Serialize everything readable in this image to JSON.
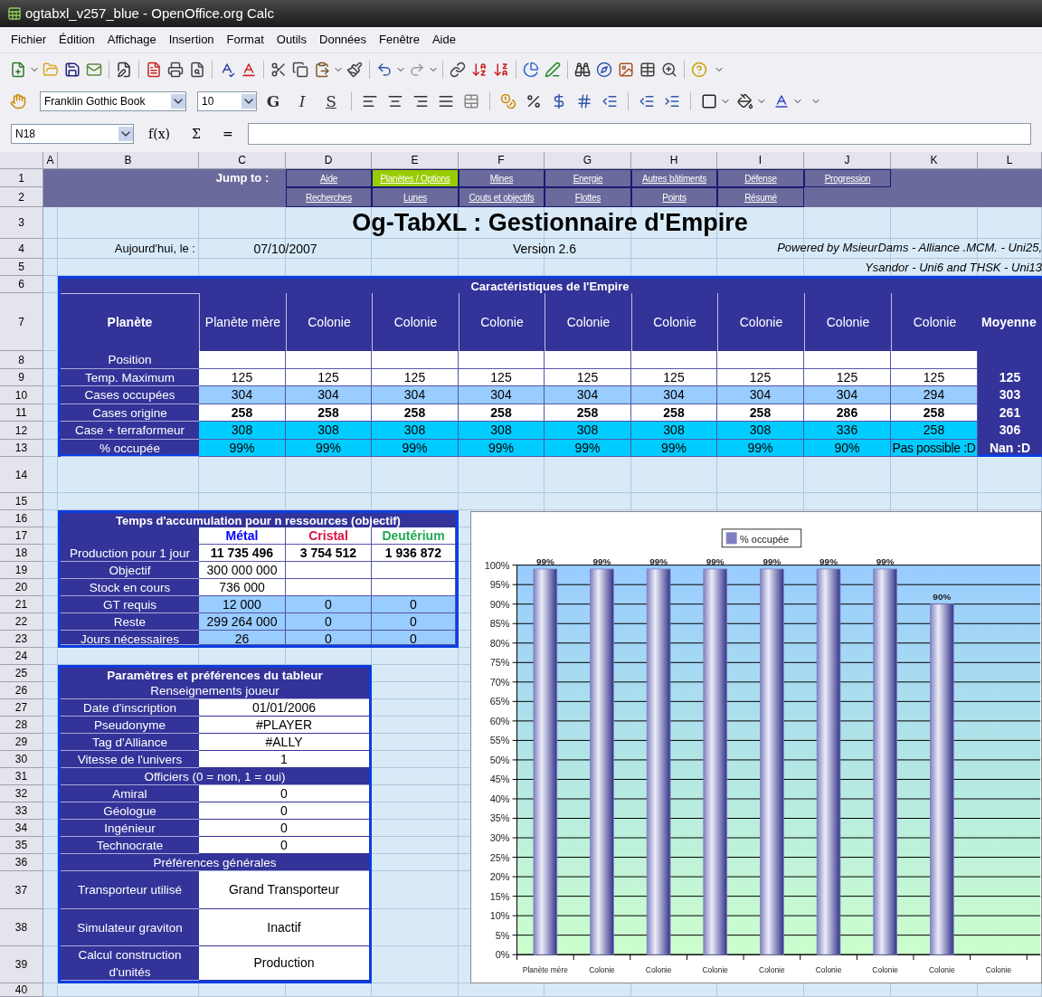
{
  "window": {
    "title": "ogtabxl_v257_blue - OpenOffice.org Calc"
  },
  "menu": [
    "Fichier",
    "Édition",
    "Affichage",
    "Insertion",
    "Format",
    "Outils",
    "Données",
    "Fenêtre",
    "Aide"
  ],
  "format_bar": {
    "font_name": "Franklin Gothic Book",
    "font_size": "10",
    "style_buttons": [
      "G",
      "I",
      "S"
    ]
  },
  "formula_bar": {
    "name_box": "N18",
    "buttons": [
      "f(x)",
      "Σ",
      "="
    ]
  },
  "sheet": {
    "columns": [
      "A",
      "B",
      "C",
      "D",
      "E",
      "F",
      "G",
      "H",
      "I",
      "J",
      "K",
      "L"
    ],
    "rows": [
      "1",
      "2",
      "3",
      "4",
      "5",
      "6",
      "7",
      "8",
      "9",
      "10",
      "11",
      "12",
      "13",
      "14",
      "15",
      "16",
      "17",
      "18",
      "19",
      "20",
      "21",
      "22",
      "23",
      "24",
      "25",
      "26",
      "27",
      "28",
      "29",
      "30",
      "31",
      "32",
      "33",
      "34",
      "35",
      "36",
      "37",
      "38",
      "39",
      "40"
    ],
    "nav": {
      "label": "Jump to :",
      "link_rows": [
        [
          {
            "text": "Aide",
            "selected": false
          },
          {
            "text": "Planètes / Options",
            "selected": true
          },
          {
            "text": "Mines",
            "selected": false
          },
          {
            "text": "Energie",
            "selected": false
          },
          {
            "text": "Autres bâtiments",
            "selected": false
          },
          {
            "text": "Défense",
            "selected": false
          },
          {
            "text": "Progression",
            "selected": false
          }
        ],
        [
          {
            "text": "Recherches",
            "selected": false
          },
          {
            "text": "Lunes",
            "selected": false
          },
          {
            "text": "Couts et objectifs",
            "selected": false
          },
          {
            "text": "Flottes",
            "selected": false
          },
          {
            "text": "Points",
            "selected": false
          },
          {
            "text": "Résumé",
            "selected": false
          }
        ]
      ]
    },
    "title": "Og-TabXL : Gestionnaire d'Empire",
    "date_label": "Aujourd'hui, le :",
    "date": "07/10/2007",
    "version": "Version 2.6",
    "credits": [
      "Powered by MsieurDams - Alliance .MCM. - Uni25,",
      "Ysandor - Uni6 and THSK - Uni13"
    ],
    "empire": {
      "title": "Caractéristiques de l'Empire",
      "row_header": "Planète",
      "average_header": "Moyenne",
      "planets": [
        "Planète mère",
        "Colonie",
        "Colonie",
        "Colonie",
        "Colonie",
        "Colonie",
        "Colonie",
        "Colonie",
        "Colonie"
      ],
      "rows": [
        {
          "label": "Position",
          "kind": "plain"
        },
        {
          "label": "Temp. Maximum",
          "kind": "plain",
          "values": [
            "125",
            "125",
            "125",
            "125",
            "125",
            "125",
            "125",
            "125",
            "125"
          ],
          "average": "125"
        },
        {
          "label": "Cases occupées",
          "kind": "shaded",
          "values": [
            "304",
            "304",
            "304",
            "304",
            "304",
            "304",
            "304",
            "304",
            "294"
          ],
          "average": "303"
        },
        {
          "label": "Cases origine",
          "kind": "bold",
          "values": [
            "258",
            "258",
            "258",
            "258",
            "258",
            "258",
            "258",
            "286",
            "258"
          ],
          "average": "261"
        },
        {
          "label": "Case + terraformeur",
          "kind": "cyan",
          "values": [
            "308",
            "308",
            "308",
            "308",
            "308",
            "308",
            "308",
            "336",
            "258"
          ],
          "average": "306"
        },
        {
          "label": "% occupée",
          "kind": "cyan",
          "values": [
            "99%",
            "99%",
            "99%",
            "99%",
            "99%",
            "99%",
            "99%",
            "90%",
            "Pas possible :D"
          ],
          "average": "Nan :D"
        }
      ]
    },
    "accumulation": {
      "title": "Temps d'accumulation pour n ressources (objectif)",
      "resources": [
        {
          "name": "Métal",
          "color": "#0000ff"
        },
        {
          "name": "Cristal",
          "color": "#dd1144"
        },
        {
          "name": "Deutérium",
          "color": "#22aa55"
        }
      ],
      "rows": [
        {
          "label": "Production pour 1 jour",
          "kind": "bold",
          "values": [
            "11 735 496",
            "3 754 512",
            "1 936 872"
          ]
        },
        {
          "label": "Objectif",
          "kind": "plain",
          "values": [
            "300 000 000"
          ]
        },
        {
          "label": "Stock en cours",
          "kind": "plain",
          "values": [
            "736 000"
          ]
        },
        {
          "label": "GT requis",
          "kind": "shaded",
          "values": [
            "12 000",
            "0",
            "0"
          ]
        },
        {
          "label": "Reste",
          "kind": "shaded",
          "values": [
            "299 264 000",
            "0",
            "0"
          ]
        },
        {
          "label": "Jours nécessaires",
          "kind": "shaded",
          "values": [
            "26",
            "0",
            "0"
          ]
        }
      ]
    },
    "parameters": {
      "title": "Paramètres et préférences du tableur",
      "rows": [
        {
          "kind": "section",
          "label": "Renseignements joueur"
        },
        {
          "kind": "field",
          "label": "Date d'inscription",
          "value": "01/01/2006"
        },
        {
          "kind": "field",
          "label": "Pseudonyme",
          "value": "#PLAYER"
        },
        {
          "kind": "field",
          "label": "Tag d'Alliance",
          "value": "#ALLY"
        },
        {
          "kind": "field",
          "label": "Vitesse de l'univers",
          "value": "1"
        },
        {
          "kind": "section",
          "label": "Officiers (0 = non, 1 = oui)"
        },
        {
          "kind": "field",
          "label": "Amiral",
          "value": "0"
        },
        {
          "kind": "field",
          "label": "Géologue",
          "value": "0"
        },
        {
          "kind": "field",
          "label": "Ingénieur",
          "value": "0"
        },
        {
          "kind": "field",
          "label": "Technocrate",
          "value": "0"
        },
        {
          "kind": "section",
          "label": "Préférences générales"
        },
        {
          "kind": "field",
          "label": "Transporteur utilisé",
          "value": "Grand Transporteur"
        },
        {
          "kind": "field",
          "label": "Simulateur graviton",
          "value": "Inactif"
        },
        {
          "kind": "field",
          "label": "Calcul construction d'unités",
          "value": "Production"
        }
      ]
    },
    "chart_data": {
      "type": "bar",
      "categories": [
        "Planète mère",
        "Colonie",
        "Colonie",
        "Colonie",
        "Colonie",
        "Colonie",
        "Colonie",
        "Colonie",
        "Colonie"
      ],
      "series": [
        {
          "name": "% occupée",
          "color": "#8080c0",
          "values": [
            99,
            99,
            99,
            99,
            99,
            99,
            99,
            90,
            null
          ]
        }
      ],
      "ylim": [
        0,
        100
      ],
      "yticks": [
        {
          "value": 0,
          "label": "0%"
        },
        {
          "value": 5,
          "label": "5%"
        },
        {
          "value": 10,
          "label": "10%"
        },
        {
          "value": 15,
          "label": "15%"
        },
        {
          "value": 20,
          "label": "20%"
        },
        {
          "value": 25,
          "label": "25%"
        },
        {
          "value": 30,
          "label": "30%"
        },
        {
          "value": 35,
          "label": "35%"
        },
        {
          "value": 40,
          "label": "40%"
        },
        {
          "value": 45,
          "label": "45%"
        },
        {
          "value": 50,
          "label": "50%"
        },
        {
          "value": 55,
          "label": "55%"
        },
        {
          "value": 60,
          "label": "60%"
        },
        {
          "value": 65,
          "label": "65%"
        },
        {
          "value": 70,
          "label": "70%"
        },
        {
          "value": 75,
          "label": "75%"
        },
        {
          "value": 80,
          "label": "80%"
        },
        {
          "value": 85,
          "label": "85%"
        },
        {
          "value": 90,
          "label": "90%"
        },
        {
          "value": 95,
          "label": "95%"
        },
        {
          "value": 100,
          "label": "100%"
        }
      ],
      "grid": true,
      "value_labels": [
        "99%",
        "99%",
        "99%",
        "99%",
        "99%",
        "99%",
        "99%",
        "90%",
        null
      ]
    }
  }
}
